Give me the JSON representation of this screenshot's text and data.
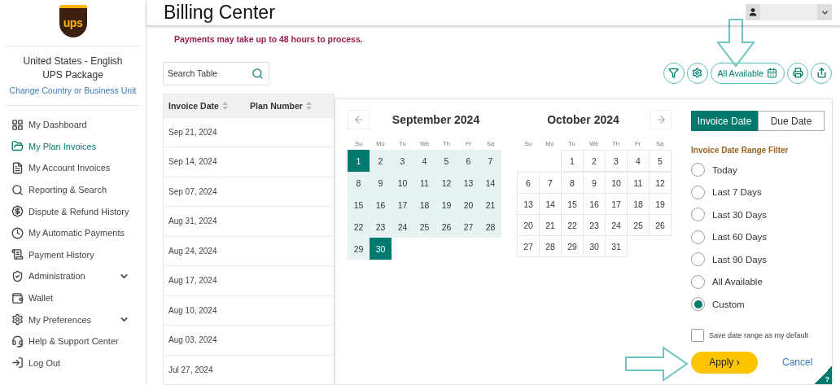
{
  "sidebar": {
    "logo": "ups",
    "locale": "United States - English",
    "business_unit": "UPS Package",
    "change_link": "Change Country or Business Unit",
    "items": [
      {
        "label": "My Dashboard",
        "selected": false
      },
      {
        "label": "My Plan Invoices",
        "selected": true
      },
      {
        "label": "My Account Invoices",
        "selected": false
      },
      {
        "label": "Reporting & Search",
        "selected": false
      },
      {
        "label": "Dispute & Refund History",
        "selected": false
      },
      {
        "label": "My Automatic Payments",
        "selected": false
      },
      {
        "label": "Payment History",
        "selected": false
      },
      {
        "label": "Administration",
        "selected": false,
        "expandable": true
      },
      {
        "label": "Wallet",
        "selected": false
      },
      {
        "label": "My Preferences",
        "selected": false,
        "expandable": true
      },
      {
        "label": "Help & Support Center",
        "selected": false
      },
      {
        "label": "Log Out",
        "selected": false
      }
    ]
  },
  "header": {
    "title": "Billing Center"
  },
  "notice": "Payments may take up to 48 hours to process.",
  "search": {
    "placeholder": "Search Table"
  },
  "toolbar": [
    {
      "kind": "filter"
    },
    {
      "kind": "settings"
    },
    {
      "kind": "range",
      "label": "All Available"
    },
    {
      "kind": "print"
    },
    {
      "kind": "export"
    }
  ],
  "table": {
    "columns": [
      "Invoice Date",
      "Plan Number"
    ],
    "rows": [
      "Sep 21, 2024",
      "Sep 14, 2024",
      "Sep 07, 2024",
      "Aug 31, 2024",
      "Aug 24, 2024",
      "Aug 17, 2024",
      "Aug 10, 2024",
      "Aug 03, 2024",
      "Jul 27, 2024"
    ]
  },
  "date_picker": {
    "months": [
      {
        "title": "September 2024",
        "weekdays": [
          "Su",
          "Mo",
          "Tu",
          "We",
          "Th",
          "Fr",
          "Sa"
        ],
        "weeks": [
          [
            {
              "kind": "day",
              "text": "1",
              "selected": true,
              "in_range": true
            },
            {
              "kind": "day",
              "text": "2",
              "selected": false,
              "in_range": true
            },
            {
              "kind": "day",
              "text": "3",
              "selected": false,
              "in_range": true
            },
            {
              "kind": "day",
              "text": "4",
              "selected": false,
              "in_range": true
            },
            {
              "kind": "day",
              "text": "5",
              "selected": false,
              "in_range": true
            },
            {
              "kind": "day",
              "text": "6",
              "selected": false,
              "in_range": true
            },
            {
              "kind": "day",
              "text": "7",
              "selected": false,
              "in_range": true
            }
          ],
          [
            {
              "kind": "day",
              "text": "8",
              "selected": false,
              "in_range": true
            },
            {
              "kind": "day",
              "text": "9",
              "selected": false,
              "in_range": true
            },
            {
              "kind": "day",
              "text": "10",
              "selected": false,
              "in_range": true
            },
            {
              "kind": "day",
              "text": "11",
              "selected": false,
              "in_range": true
            },
            {
              "kind": "day",
              "text": "12",
              "selected": false,
              "in_range": true
            },
            {
              "kind": "day",
              "text": "13",
              "selected": false,
              "in_range": true
            },
            {
              "kind": "day",
              "text": "14",
              "selected": false,
              "in_range": true
            }
          ],
          [
            {
              "kind": "day",
              "text": "15",
              "selected": false,
              "in_range": true
            },
            {
              "kind": "day",
              "text": "16",
              "selected": false,
              "in_range": true
            },
            {
              "kind": "day",
              "text": "17",
              "selected": false,
              "in_range": true
            },
            {
              "kind": "day",
              "text": "18",
              "selected": false,
              "in_range": true
            },
            {
              "kind": "day",
              "text": "19",
              "selected": false,
              "in_range": true
            },
            {
              "kind": "day",
              "text": "20",
              "selected": false,
              "in_range": true
            },
            {
              "kind": "day",
              "text": "21",
              "selected": false,
              "in_range": true
            }
          ],
          [
            {
              "kind": "day",
              "text": "22",
              "selected": false,
              "in_range": true
            },
            {
              "kind": "day",
              "text": "23",
              "selected": false,
              "in_range": true
            },
            {
              "kind": "day",
              "text": "24",
              "selected": false,
              "in_range": true
            },
            {
              "kind": "day",
              "text": "25",
              "selected": false,
              "in_range": true
            },
            {
              "kind": "day",
              "text": "26",
              "selected": false,
              "in_range": true
            },
            {
              "kind": "day",
              "text": "27",
              "selected": false,
              "in_range": true
            },
            {
              "kind": "day",
              "text": "28",
              "selected": false,
              "in_range": true
            }
          ],
          [
            {
              "kind": "day",
              "text": "29",
              "selected": false,
              "in_range": true
            },
            {
              "kind": "day",
              "text": "30",
              "selected": true,
              "in_range": true
            }
          ]
        ]
      },
      {
        "title": "October 2024",
        "weekdays": [
          "Su",
          "Mo",
          "Tu",
          "We",
          "Th",
          "Fr",
          "Sa"
        ],
        "weeks": [
          [
            {
              "kind": "blank"
            },
            {
              "kind": "blank"
            },
            {
              "kind": "day",
              "text": "1",
              "selected": false,
              "in_range": false
            },
            {
              "kind": "day",
              "text": "2",
              "selected": false,
              "in_range": false
            },
            {
              "kind": "day",
              "text": "3",
              "selected": false,
              "in_range": false
            },
            {
              "kind": "day",
              "text": "4",
              "selected": false,
              "in_range": false
            },
            {
              "kind": "day",
              "text": "5",
              "selected": false,
              "in_range": false
            }
          ],
          [
            {
              "kind": "day",
              "text": "6",
              "selected": false,
              "in_range": false
            },
            {
              "kind": "day",
              "text": "7",
              "selected": false,
              "in_range": false
            },
            {
              "kind": "day",
              "text": "8",
              "selected": false,
              "in_range": false
            },
            {
              "kind": "day",
              "text": "9",
              "selected": false,
              "in_range": false
            },
            {
              "kind": "day",
              "text": "10",
              "selected": false,
              "in_range": false
            },
            {
              "kind": "day",
              "text": "11",
              "selected": false,
              "in_range": false
            },
            {
              "kind": "day",
              "text": "12",
              "selected": false,
              "in_range": false
            }
          ],
          [
            {
              "kind": "day",
              "text": "13",
              "selected": false,
              "in_range": false
            },
            {
              "kind": "day",
              "text": "14",
              "selected": false,
              "in_range": false
            },
            {
              "kind": "day",
              "text": "15",
              "selected": false,
              "in_range": false
            },
            {
              "kind": "day",
              "text": "16",
              "selected": false,
              "in_range": false
            },
            {
              "kind": "day",
              "text": "17",
              "selected": false,
              "in_range": false
            },
            {
              "kind": "day",
              "text": "18",
              "selected": false,
              "in_range": false
            },
            {
              "kind": "day",
              "text": "19",
              "selected": false,
              "in_range": false
            }
          ],
          [
            {
              "kind": "day",
              "text": "20",
              "selected": false,
              "in_range": false
            },
            {
              "kind": "day",
              "text": "21",
              "selected": false,
              "in_range": false
            },
            {
              "kind": "day",
              "text": "22",
              "selected": false,
              "in_range": false
            },
            {
              "kind": "day",
              "text": "23",
              "selected": false,
              "in_range": false
            },
            {
              "kind": "day",
              "text": "24",
              "selected": false,
              "in_range": false
            },
            {
              "kind": "day",
              "text": "25",
              "selected": false,
              "in_range": false
            },
            {
              "kind": "day",
              "text": "26",
              "selected": false,
              "in_range": false
            }
          ],
          [
            {
              "kind": "day",
              "text": "27",
              "selected": false,
              "in_range": false
            },
            {
              "kind": "day",
              "text": "28",
              "selected": false,
              "in_range": false
            },
            {
              "kind": "day",
              "text": "29",
              "selected": false,
              "in_range": false
            },
            {
              "kind": "day",
              "text": "30",
              "selected": false,
              "in_range": false
            },
            {
              "kind": "day",
              "text": "31",
              "selected": false,
              "in_range": false
            }
          ]
        ]
      }
    ],
    "tabs": [
      {
        "label": "Invoice Date",
        "selected": true
      },
      {
        "label": "Due Date",
        "selected": false
      }
    ],
    "filter_title": "Invoice Date Range Filter",
    "options": [
      {
        "label": "Today",
        "selected": false
      },
      {
        "label": "Last 7 Days",
        "selected": false
      },
      {
        "label": "Last 30 Days",
        "selected": false
      },
      {
        "label": "Last 60 Days",
        "selected": false
      },
      {
        "label": "Last 90 Days",
        "selected": false
      },
      {
        "label": "All Available",
        "selected": false
      },
      {
        "label": "Custom",
        "selected": true
      }
    ],
    "save_default": {
      "label": "Save date range as my default",
      "checked": false
    },
    "apply": "Apply ›",
    "cancel": "Cancel",
    "help": "?"
  }
}
